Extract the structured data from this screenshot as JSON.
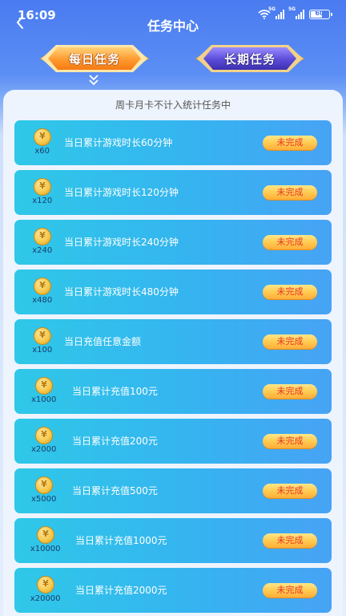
{
  "status_bar": {
    "time": "16:09",
    "battery": "60",
    "network_labels": [
      "5G",
      "5G"
    ]
  },
  "header": {
    "title": "任务中心",
    "back_icon": "chevron-left-icon"
  },
  "tabs": [
    {
      "label": "每日任务",
      "active": true
    },
    {
      "label": "长期任务",
      "active": false
    }
  ],
  "notice": "周卡月卡不计入统计任务中",
  "tasks": [
    {
      "reward": "x60",
      "title": "当日累计游戏时长60分钟",
      "status": "未完成"
    },
    {
      "reward": "x120",
      "title": "当日累计游戏时长120分钟",
      "status": "未完成"
    },
    {
      "reward": "x240",
      "title": "当日累计游戏时长240分钟",
      "status": "未完成"
    },
    {
      "reward": "x480",
      "title": "当日累计游戏时长480分钟",
      "status": "未完成"
    },
    {
      "reward": "x100",
      "title": "当日充值任意金额",
      "status": "未完成"
    },
    {
      "reward": "x1000",
      "title": "当日累计充值100元",
      "status": "未完成"
    },
    {
      "reward": "x2000",
      "title": "当日累计充值200元",
      "status": "未完成"
    },
    {
      "reward": "x5000",
      "title": "当日累计充值500元",
      "status": "未完成"
    },
    {
      "reward": "x10000",
      "title": "当日累计充值1000元",
      "status": "未完成"
    },
    {
      "reward": "x20000",
      "title": "当日累计充值2000元",
      "status": "未完成"
    }
  ]
}
